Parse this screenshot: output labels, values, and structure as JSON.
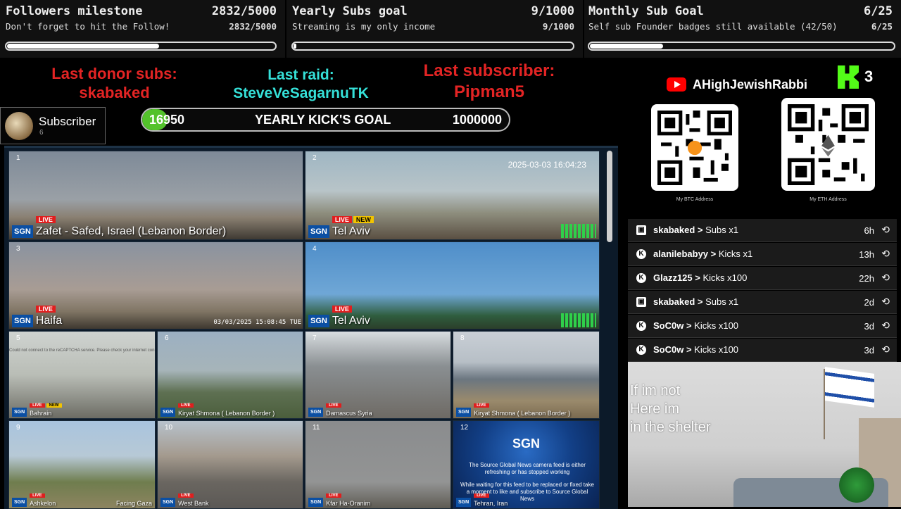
{
  "goals": [
    {
      "title": "Followers milestone",
      "title_value": "2832/5000",
      "subtitle": "Don't forget to hit the Follow!",
      "sub_value": "2832/5000",
      "progress": 0.566
    },
    {
      "title": "Yearly Subs goal",
      "title_value": "9/1000",
      "subtitle": "Streaming is my only income",
      "sub_value": "9/1000",
      "progress": 0.009
    },
    {
      "title": "Monthly Sub Goal",
      "title_value": "6/25",
      "subtitle": "Self sub Founder badges still available (42/50)",
      "sub_value": "6/25",
      "progress": 0.24
    }
  ],
  "alerts": {
    "donor_label": "Last donor subs:",
    "donor_name": "skabaked",
    "raid_label": "Last raid:",
    "raid_name": "SteveVeSagarnuTK",
    "sub_label": "Last subscriber:",
    "sub_name": "Pipman5"
  },
  "subscriber_box": {
    "label": "Subscriber",
    "count": "6"
  },
  "kick_goal": {
    "current": "16950",
    "title": "YEARLY KICK'S GOAL",
    "target": "1000000",
    "progress": 0.017
  },
  "cameras": [
    {
      "num": "1",
      "brand": "SGN",
      "live": "LIVE",
      "name": "Zafet - Safed, Israel (Lebanon Border)"
    },
    {
      "num": "2",
      "brand": "SGN",
      "live": "LIVE",
      "badge": "NEW",
      "name": "Tel Aviv",
      "timestamp": "2025-03-03 16:04:23"
    },
    {
      "num": "3",
      "brand": "SGN",
      "live": "LIVE",
      "name": "Haifa",
      "timestamp": "03/03/2025 15:08:45 TUE"
    },
    {
      "num": "4",
      "brand": "SGN",
      "live": "LIVE",
      "name": "Tel Aviv"
    },
    {
      "num": "5",
      "brand": "SGN",
      "live": "LIVE",
      "badge": "NEW",
      "name": "Bahrain",
      "error": "Could not connect to the reCAPTCHA service. Please check your internet connection and reload to get a reCAPTCHA challenge."
    },
    {
      "num": "6",
      "brand": "SGN",
      "live": "LIVE",
      "name": "Kiryat Shmona ( Lebanon Border )"
    },
    {
      "num": "7",
      "brand": "SGN",
      "live": "LIVE",
      "name": "Damascus Syria"
    },
    {
      "num": "8",
      "brand": "SGN",
      "live": "LIVE",
      "name": "Kiryat Shmona ( Lebanon Border )"
    },
    {
      "num": "9",
      "brand": "SGN",
      "live": "LIVE",
      "name": "Ashkelon"
    },
    {
      "num": "10",
      "brand": "SGN",
      "live": "LIVE",
      "name": "West Bank"
    },
    {
      "num": "11",
      "brand": "SGN",
      "live": "LIVE",
      "name": "Kfar Ha-Oranim"
    },
    {
      "num": "12",
      "brand": "SGN",
      "live": "LIVE",
      "name": "Tehran, Iran",
      "placeholder_logo": "SGN",
      "placeholder_text": "The Source Global News camera feed is either refreshing or has stopped working",
      "placeholder_text2": "While waiting for this feed to be replaced or fixed take a moment to like and subscribe to Source Global News"
    }
  ],
  "extra_labels": {
    "facing_gaza": "Facing Gaza"
  },
  "channel": {
    "name": "AHighJewishRabbi",
    "kick_count": "3"
  },
  "qr": [
    {
      "caption": "My BTC Address"
    },
    {
      "caption": "My ETH Address"
    }
  ],
  "activity": [
    {
      "icon": "gift",
      "name": "skabaked",
      "action": "Subs x1",
      "time": "6h"
    },
    {
      "icon": "kick",
      "name": "alanilebabyy",
      "action": "Kicks x1",
      "time": "13h"
    },
    {
      "icon": "kick",
      "name": "Glazz125",
      "action": "Kicks x100",
      "time": "22h"
    },
    {
      "icon": "gift",
      "name": "skabaked",
      "action": "Subs x1",
      "time": "2d"
    },
    {
      "icon": "kick",
      "name": "SoC0w",
      "action": "Kicks x100",
      "time": "3d"
    },
    {
      "icon": "kick",
      "name": "SoC0w",
      "action": "Kicks x100",
      "time": "3d"
    }
  ],
  "webcam": {
    "line1": "If im not",
    "line2": "Here im",
    "line3": "in the shelter"
  },
  "colors": {
    "alert_red": "#e32424",
    "raid_cyan": "#35e0d8",
    "kick_green": "#53c22b",
    "sgn_blue": "#0b4fa3"
  }
}
